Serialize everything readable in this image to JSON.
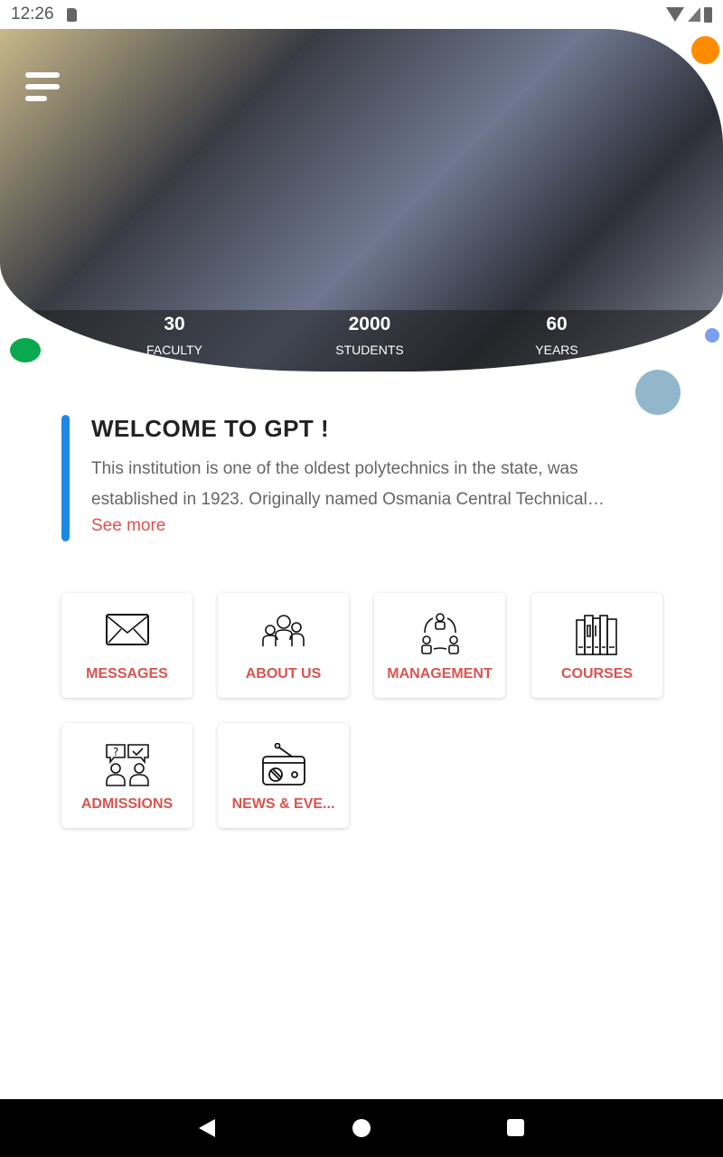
{
  "status_bar": {
    "time": "12:26"
  },
  "hero": {
    "stats": [
      {
        "value": "30",
        "label": "FACULTY"
      },
      {
        "value": "2000",
        "label": "STUDENTS"
      },
      {
        "value": "60",
        "label": "YEARS"
      }
    ]
  },
  "welcome": {
    "title": "WELCOME TO GPT !",
    "description": "This institution is one of the oldest polytechnics in the state, was established in 1923. Originally named Osmania Central Technical…",
    "see_more": "See more"
  },
  "tiles": [
    {
      "label": "MESSAGES",
      "icon": "envelope-icon"
    },
    {
      "label": "ABOUT US",
      "icon": "group-icon"
    },
    {
      "label": "MANAGEMENT",
      "icon": "management-cycle-icon"
    },
    {
      "label": "COURSES",
      "icon": "books-icon"
    },
    {
      "label": "ADMISSIONS",
      "icon": "question-answer-icon"
    },
    {
      "label": "NEWS & EVE...",
      "icon": "radio-icon"
    }
  ],
  "colors": {
    "accent_red": "#d9534f",
    "accent_blue": "#1e88e5",
    "dot_orange": "#ff8c00",
    "dot_green": "#0aa84f",
    "dot_blue": "#7b9ff0",
    "dot_grey_blue": "#92b7cc"
  }
}
